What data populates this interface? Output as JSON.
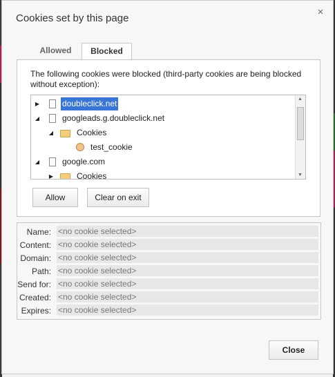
{
  "dialog": {
    "title": "Cookies set by this page",
    "close_glyph": "×"
  },
  "tabs": [
    {
      "label": "Allowed",
      "active": false
    },
    {
      "label": "Blocked",
      "active": true
    }
  ],
  "blocked_panel": {
    "description": "The following cookies were blocked (third-party cookies are being blocked without exception):",
    "tree": [
      {
        "label": "doubleclick.net",
        "icon": "file-icon",
        "arrow": "▶",
        "selected": true
      },
      {
        "label": "googleads.g.doubleclick.net",
        "icon": "file-icon",
        "arrow": "◢",
        "selected": false
      },
      {
        "label": "Cookies",
        "icon": "folder-icon",
        "arrow": "◢",
        "selected": false
      },
      {
        "label": "test_cookie",
        "icon": "cookie-icon",
        "arrow": "",
        "selected": false
      },
      {
        "label": "google.com",
        "icon": "file-icon",
        "arrow": "◢",
        "selected": false
      },
      {
        "label": "Cookies",
        "icon": "folder-icon",
        "arrow": "▶",
        "selected": false
      }
    ],
    "allow_button": "Allow",
    "clear_on_exit_button": "Clear on exit"
  },
  "details": {
    "rows": [
      {
        "label": "Name:",
        "value": "<no cookie selected>"
      },
      {
        "label": "Content:",
        "value": "<no cookie selected>"
      },
      {
        "label": "Domain:",
        "value": "<no cookie selected>"
      },
      {
        "label": "Path:",
        "value": "<no cookie selected>"
      },
      {
        "label": "Send for:",
        "value": "<no cookie selected>"
      },
      {
        "label": "Created:",
        "value": "<no cookie selected>"
      },
      {
        "label": "Expires:",
        "value": "<no cookie selected>"
      }
    ]
  },
  "footer": {
    "close_button": "Close"
  },
  "colors": {
    "selection": "#3875d7",
    "dialog_bg": "#f7f7f7",
    "left_strip": "#b01c5a",
    "right_strip": "#2a6b2a"
  }
}
